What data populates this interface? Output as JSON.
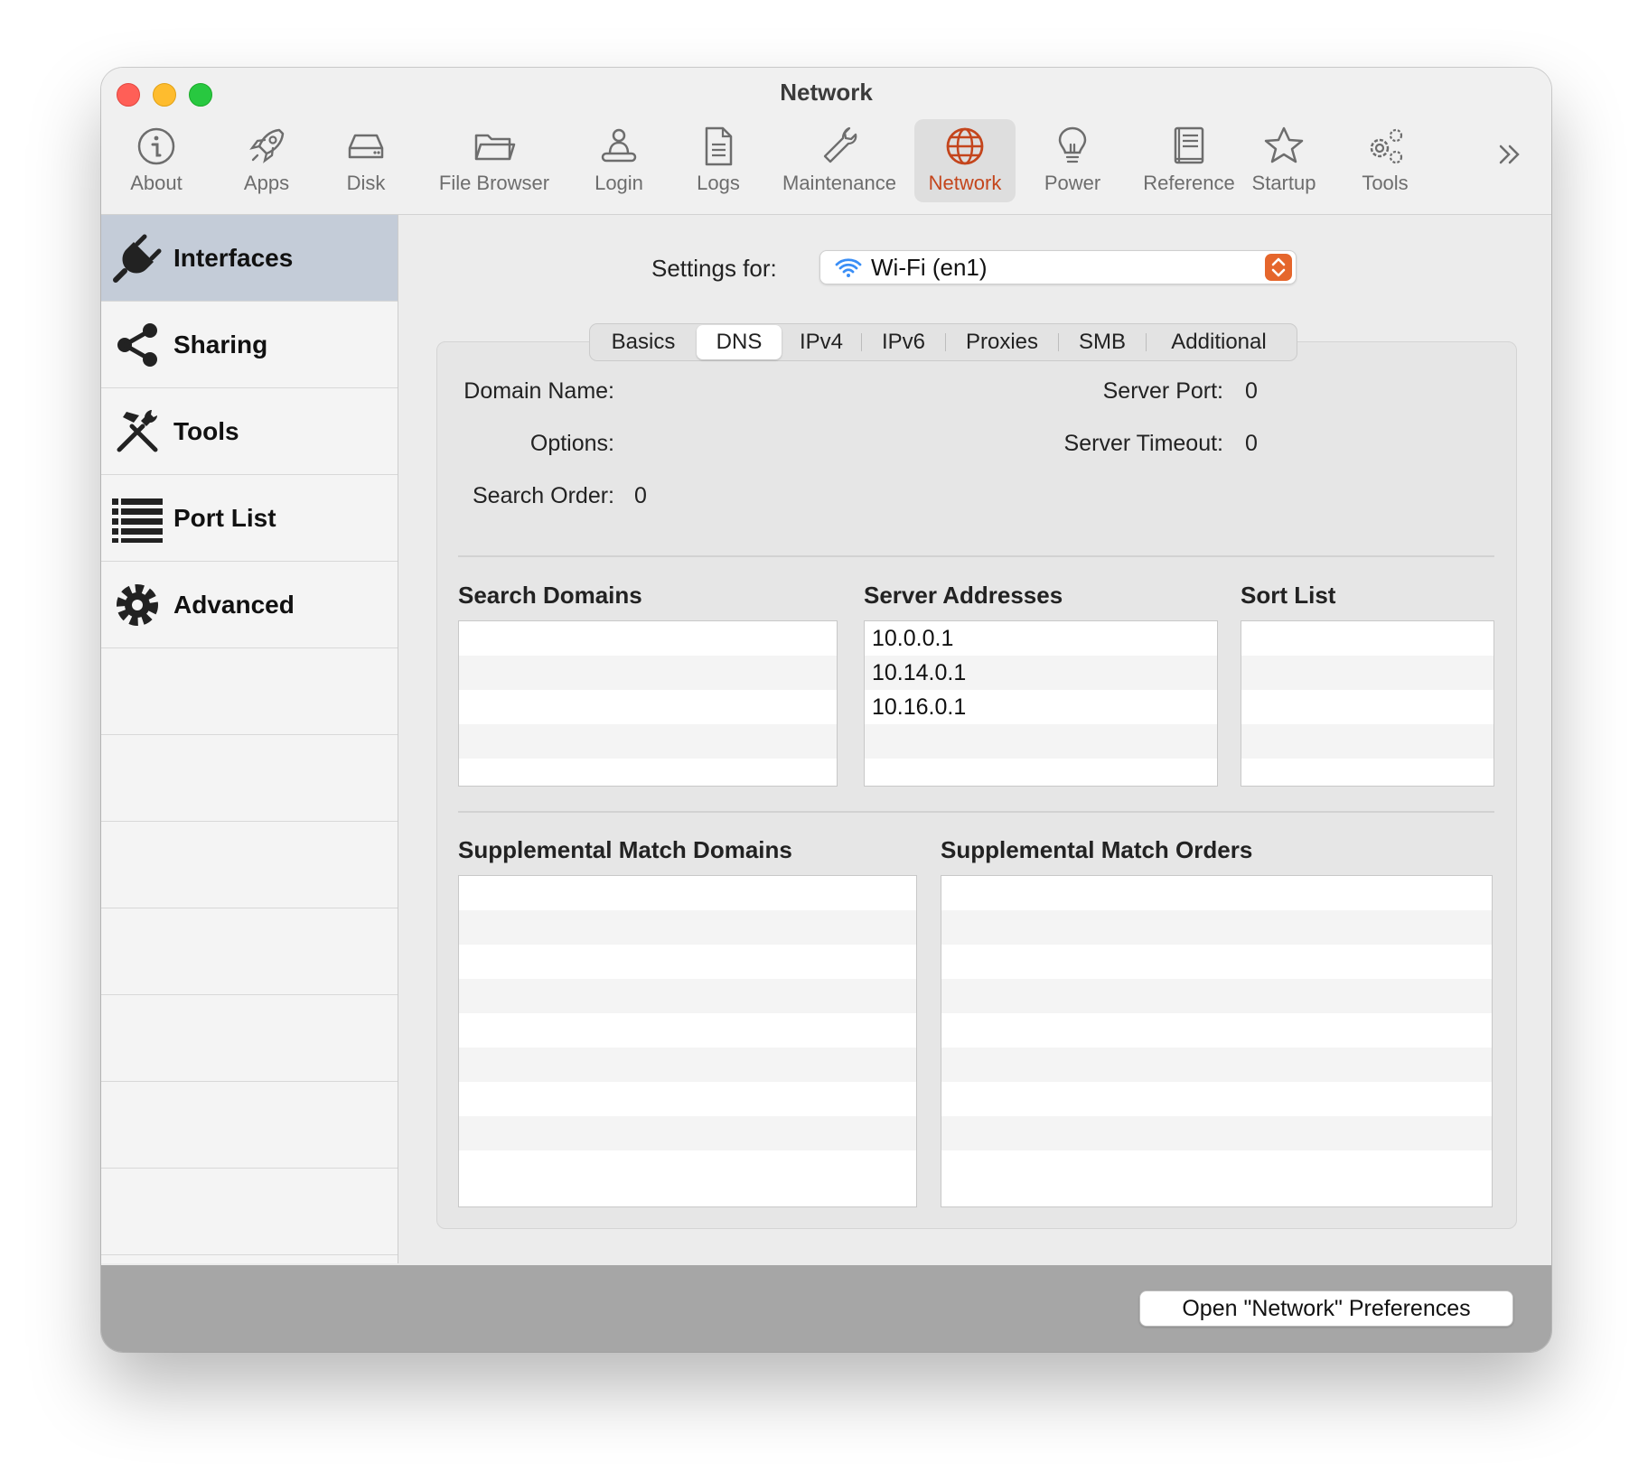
{
  "window": {
    "title": "Network"
  },
  "toolbar": {
    "items": [
      {
        "label": "About",
        "icon": "info-icon"
      },
      {
        "label": "Apps",
        "icon": "rocket-icon"
      },
      {
        "label": "Disk",
        "icon": "disk-icon"
      },
      {
        "label": "File Browser",
        "icon": "folder-icon"
      },
      {
        "label": "Login",
        "icon": "user-icon"
      },
      {
        "label": "Logs",
        "icon": "document-icon"
      },
      {
        "label": "Maintenance",
        "icon": "wrench-icon"
      },
      {
        "label": "Network",
        "icon": "globe-icon"
      },
      {
        "label": "Power",
        "icon": "lightbulb-icon"
      },
      {
        "label": "Reference",
        "icon": "book-icon"
      },
      {
        "label": "Startup",
        "icon": "star-icon"
      },
      {
        "label": "Tools",
        "icon": "gears-icon"
      }
    ],
    "selected": "Network",
    "accent_color": "#c4451c"
  },
  "sidebar": {
    "items": [
      {
        "label": "Interfaces",
        "icon": "plug-icon"
      },
      {
        "label": "Sharing",
        "icon": "share-icon"
      },
      {
        "label": "Tools",
        "icon": "hammer-wrench-icon"
      },
      {
        "label": "Port List",
        "icon": "list-icon"
      },
      {
        "label": "Advanced",
        "icon": "gear-icon"
      }
    ],
    "selected": "Interfaces"
  },
  "settings": {
    "label": "Settings for:",
    "interface": "Wi-Fi (en1)"
  },
  "tabs": {
    "items": [
      "Basics",
      "DNS",
      "IPv4",
      "IPv6",
      "Proxies",
      "SMB",
      "Additional"
    ],
    "selected": "DNS"
  },
  "dns": {
    "domain_name_label": "Domain Name:",
    "domain_name": "",
    "options_label": "Options:",
    "options": "",
    "search_order_label": "Search Order:",
    "search_order": "0",
    "server_port_label": "Server Port:",
    "server_port": "0",
    "server_timeout_label": "Server Timeout:",
    "server_timeout": "0",
    "search_domains_title": "Search Domains",
    "search_domains": [
      "",
      "",
      "",
      ""
    ],
    "server_addresses_title": "Server Addresses",
    "server_addresses": [
      "10.0.0.1",
      "10.14.0.1",
      "10.16.0.1",
      ""
    ],
    "sort_list_title": "Sort List",
    "sort_list": [
      "",
      "",
      "",
      ""
    ],
    "supp_domains_title": "Supplemental Match Domains",
    "supp_domains": [
      "",
      "",
      "",
      "",
      "",
      "",
      "",
      ""
    ],
    "supp_orders_title": "Supplemental Match Orders",
    "supp_orders": [
      "",
      "",
      "",
      "",
      "",
      "",
      "",
      ""
    ]
  },
  "footer": {
    "open_prefs_label": "Open \"Network\" Preferences"
  }
}
